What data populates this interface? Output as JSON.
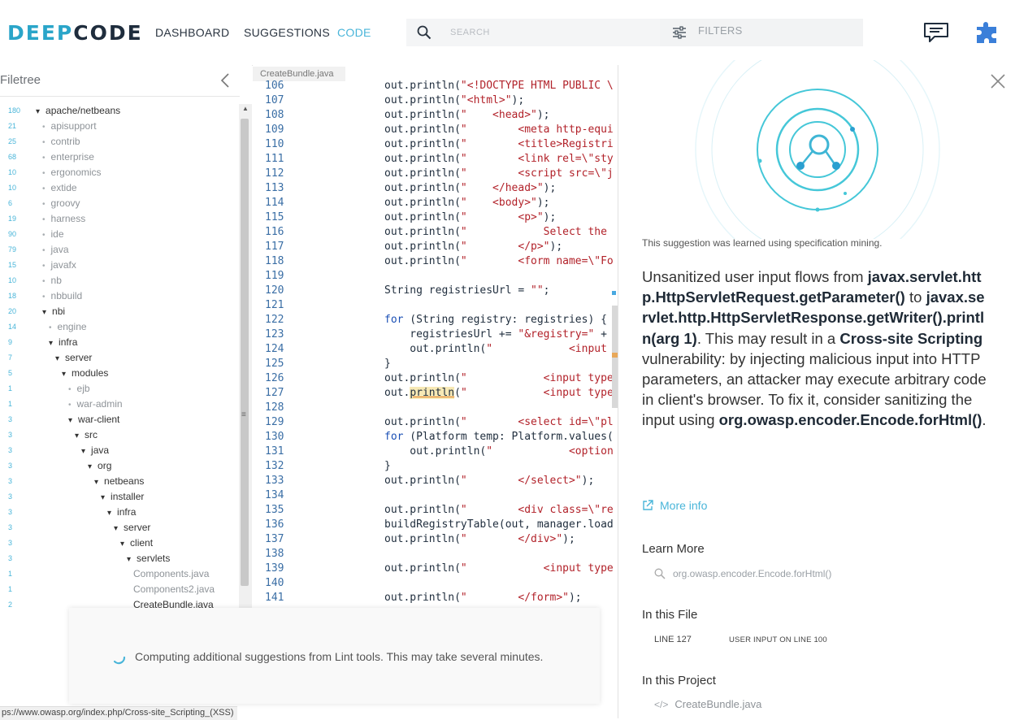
{
  "header": {
    "logo_left": "DEEP",
    "logo_right": "CODE",
    "nav": [
      {
        "label": "DASHBOARD",
        "active": false
      },
      {
        "label": "SUGGESTIONS",
        "active": false
      },
      {
        "label": "CODE",
        "active": true
      }
    ],
    "search_placeholder": "SEARCH",
    "filters_label": "FILTERS",
    "icons": [
      "search-icon",
      "filters-icon",
      "feedback-icon",
      "plugin-icon"
    ]
  },
  "filetree": {
    "title": "Filetree",
    "items": [
      {
        "count": "180",
        "label": "apache/netbeans",
        "depth": 0,
        "light": false
      },
      {
        "count": "21",
        "label": "apisupport",
        "depth": 1,
        "light": true
      },
      {
        "count": "25",
        "label": "contrib",
        "depth": 1,
        "light": true
      },
      {
        "count": "68",
        "label": "enterprise",
        "depth": 1,
        "light": true
      },
      {
        "count": "10",
        "label": "ergonomics",
        "depth": 1,
        "light": true
      },
      {
        "count": "10",
        "label": "extide",
        "depth": 1,
        "light": true
      },
      {
        "count": "6",
        "label": "groovy",
        "depth": 1,
        "light": true
      },
      {
        "count": "19",
        "label": "harness",
        "depth": 1,
        "light": true
      },
      {
        "count": "90",
        "label": "ide",
        "depth": 1,
        "light": true
      },
      {
        "count": "79",
        "label": "java",
        "depth": 1,
        "light": true
      },
      {
        "count": "15",
        "label": "javafx",
        "depth": 1,
        "light": true
      },
      {
        "count": "10",
        "label": "nb",
        "depth": 1,
        "light": true
      },
      {
        "count": "18",
        "label": "nbbuild",
        "depth": 1,
        "light": true
      },
      {
        "count": "20",
        "label": "nbi",
        "depth": 1,
        "light": false
      },
      {
        "count": "14",
        "label": "engine",
        "depth": 2,
        "light": true
      },
      {
        "count": "9",
        "label": "infra",
        "depth": 2,
        "light": false
      },
      {
        "count": "7",
        "label": "server",
        "depth": 3,
        "light": false
      },
      {
        "count": "5",
        "label": "modules",
        "depth": 4,
        "light": false
      },
      {
        "count": "1",
        "label": "ejb",
        "depth": 5,
        "light": true
      },
      {
        "count": "1",
        "label": "war-admin",
        "depth": 5,
        "light": true
      },
      {
        "count": "3",
        "label": "war-client",
        "depth": 5,
        "light": false
      },
      {
        "count": "3",
        "label": "src",
        "depth": 6,
        "light": false
      },
      {
        "count": "3",
        "label": "java",
        "depth": 7,
        "light": false
      },
      {
        "count": "3",
        "label": "org",
        "depth": 8,
        "light": false
      },
      {
        "count": "3",
        "label": "netbeans",
        "depth": 9,
        "light": false
      },
      {
        "count": "3",
        "label": "installer",
        "depth": 10,
        "light": false
      },
      {
        "count": "3",
        "label": "infra",
        "depth": 11,
        "light": false
      },
      {
        "count": "3",
        "label": "server",
        "depth": 12,
        "light": false
      },
      {
        "count": "3",
        "label": "client",
        "depth": 13,
        "light": false
      },
      {
        "count": "3",
        "label": "servlets",
        "depth": 14,
        "light": false
      },
      {
        "count": "1",
        "label": "Components.java",
        "depth": 15,
        "light": true,
        "file": true
      },
      {
        "count": "1",
        "label": "Components2.java",
        "depth": 15,
        "light": true,
        "file": true
      },
      {
        "count": "2",
        "label": "CreateBundle.java",
        "depth": 15,
        "light": false,
        "file": true
      }
    ]
  },
  "editor": {
    "tab": "CreateBundle.java",
    "lines": [
      {
        "n": "106",
        "code": [
          [
            "",
            "out.println("
          ],
          [
            "str",
            "\"<!DOCTYPE HTML PUBLIC \\"
          ]
        ]
      },
      {
        "n": "107",
        "code": [
          [
            "",
            "out.println("
          ],
          [
            "str",
            "\"<html>\""
          ],
          [
            "",
            ");"
          ]
        ]
      },
      {
        "n": "108",
        "code": [
          [
            "",
            "out.println("
          ],
          [
            "str",
            "\"    <head>\""
          ],
          [
            "",
            ");"
          ]
        ]
      },
      {
        "n": "109",
        "code": [
          [
            "",
            "out.println("
          ],
          [
            "str",
            "\"        <meta http-equi"
          ]
        ]
      },
      {
        "n": "110",
        "code": [
          [
            "",
            "out.println("
          ],
          [
            "str",
            "\"        <title>Registri"
          ]
        ]
      },
      {
        "n": "111",
        "code": [
          [
            "",
            "out.println("
          ],
          [
            "str",
            "\"        <link rel=\\\"sty"
          ]
        ]
      },
      {
        "n": "112",
        "code": [
          [
            "",
            "out.println("
          ],
          [
            "str",
            "\"        <script src=\\\"j"
          ]
        ]
      },
      {
        "n": "113",
        "code": [
          [
            "",
            "out.println("
          ],
          [
            "str",
            "\"    </head>\""
          ],
          [
            "",
            ");"
          ]
        ]
      },
      {
        "n": "114",
        "code": [
          [
            "",
            "out.println("
          ],
          [
            "str",
            "\"    <body>\""
          ],
          [
            "",
            ");"
          ]
        ]
      },
      {
        "n": "115",
        "code": [
          [
            "",
            "out.println("
          ],
          [
            "str",
            "\"        <p>\""
          ],
          [
            "",
            ");"
          ]
        ]
      },
      {
        "n": "116",
        "code": [
          [
            "",
            "out.println("
          ],
          [
            "str",
            "\"            Select the "
          ]
        ]
      },
      {
        "n": "117",
        "code": [
          [
            "",
            "out.println("
          ],
          [
            "str",
            "\"        </p>\""
          ],
          [
            "",
            ");"
          ]
        ]
      },
      {
        "n": "118",
        "code": [
          [
            "",
            "out.println("
          ],
          [
            "str",
            "\"        <form name=\\\"Fo"
          ]
        ]
      },
      {
        "n": "119",
        "code": []
      },
      {
        "n": "120",
        "code": [
          [
            "",
            "String registriesUrl = "
          ],
          [
            "str",
            "\"\""
          ],
          [
            "",
            ";"
          ]
        ]
      },
      {
        "n": "121",
        "code": []
      },
      {
        "n": "122",
        "code": [
          [
            "kw",
            "for"
          ],
          [
            "",
            " (String registry: registries) {"
          ]
        ]
      },
      {
        "n": "123",
        "code": [
          [
            "",
            "    registriesUrl += "
          ],
          [
            "str",
            "\"&registry=\""
          ],
          [
            "",
            " +"
          ]
        ]
      },
      {
        "n": "124",
        "code": [
          [
            "",
            "    out.println("
          ],
          [
            "str",
            "\"            <input"
          ]
        ]
      },
      {
        "n": "125",
        "code": [
          [
            "",
            "}"
          ]
        ]
      },
      {
        "n": "126",
        "code": [
          [
            "",
            "out.println("
          ],
          [
            "str",
            "\"            <input type"
          ]
        ]
      },
      {
        "n": "127",
        "code": [
          [
            "",
            "out."
          ],
          [
            "hl",
            "println"
          ],
          [
            "",
            "("
          ],
          [
            "str",
            "\"            <input type"
          ]
        ]
      },
      {
        "n": "128",
        "code": []
      },
      {
        "n": "129",
        "code": [
          [
            "",
            "out.println("
          ],
          [
            "str",
            "\"        <select id=\\\"pl"
          ]
        ]
      },
      {
        "n": "130",
        "code": [
          [
            "kw",
            "for"
          ],
          [
            "",
            " (Platform temp: Platform.values("
          ]
        ]
      },
      {
        "n": "131",
        "code": [
          [
            "",
            "    out.println("
          ],
          [
            "str",
            "\"            <option"
          ]
        ]
      },
      {
        "n": "132",
        "code": [
          [
            "",
            "}"
          ]
        ]
      },
      {
        "n": "133",
        "code": [
          [
            "",
            "out.println("
          ],
          [
            "str",
            "\"        </select>\""
          ],
          [
            "",
            ");"
          ]
        ]
      },
      {
        "n": "134",
        "code": []
      },
      {
        "n": "135",
        "code": [
          [
            "",
            "out.println("
          ],
          [
            "str",
            "\"        <div class=\\\"re"
          ]
        ]
      },
      {
        "n": "136",
        "code": [
          [
            "",
            "buildRegistryTable(out, manager.load"
          ]
        ]
      },
      {
        "n": "137",
        "code": [
          [
            "",
            "out.println("
          ],
          [
            "str",
            "\"        </div>\""
          ],
          [
            "",
            ");"
          ]
        ]
      },
      {
        "n": "138",
        "code": []
      },
      {
        "n": "139",
        "code": [
          [
            "",
            "out.println("
          ],
          [
            "str",
            "\"            <input type"
          ]
        ]
      },
      {
        "n": "140",
        "code": []
      },
      {
        "n": "141",
        "code": [
          [
            "",
            "out.println("
          ],
          [
            "str",
            "\"        </form>\""
          ],
          [
            "",
            ");"
          ]
        ]
      }
    ]
  },
  "toast": {
    "message": "Computing additional suggestions from Lint tools. This may take several minutes."
  },
  "status_url": "ps://www.owasp.org/index.php/Cross-site_Scripting_(XSS)",
  "panel": {
    "mining_note": "This suggestion was learned using specification mining.",
    "description_parts": [
      [
        "",
        "Unsanitized user input flows from "
      ],
      [
        "b",
        "javax.servlet.http.HttpServletRequest.getParameter()"
      ],
      [
        "",
        " to "
      ],
      [
        "b",
        "javax.servlet.http.HttpServletResponse.getWriter().println(arg 1)"
      ],
      [
        "",
        ". This may result in a "
      ],
      [
        "b",
        "Cross-site Scripting"
      ],
      [
        "",
        " vulnerability: by injecting malicious input into HTTP parameters, an attacker may execute arbitrary code in client's browser. To fix it, consider sanitizing the input using "
      ],
      [
        "b",
        "org.owasp.encoder.Encode.forHtml()"
      ],
      [
        "",
        "."
      ]
    ],
    "more_info": "More info",
    "learn_more_title": "Learn More",
    "learn_search": "org.owasp.encoder.Encode.forHtml()",
    "in_file_title": "In this File",
    "line_link": "LINE 127",
    "input_link": "USER INPUT ON LINE 100",
    "in_project_title": "In this Project",
    "project_file": "CreateBundle.java",
    "accent": "#49b5d9"
  }
}
